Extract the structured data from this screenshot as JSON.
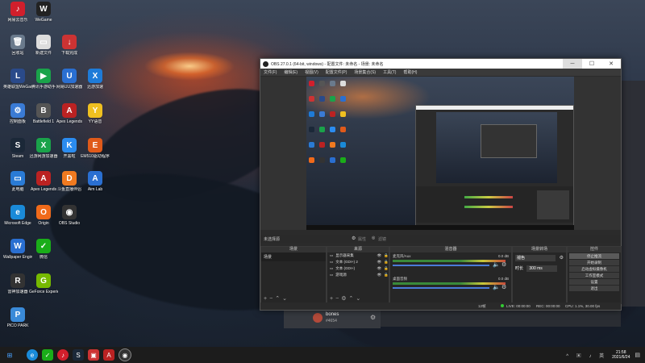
{
  "desktop": {
    "icons": [
      {
        "label": "网易云音乐",
        "color": "#d11f2c",
        "glyph": "♪"
      },
      {
        "label": "WeGame",
        "color": "#222",
        "glyph": "W"
      },
      {
        "label": "回收站",
        "color": "#6a7a8c",
        "glyph": "🗑"
      },
      {
        "label": "新建文件",
        "color": "#ddd",
        "glyph": "▭"
      },
      {
        "label": "下载完成",
        "color": "#c33",
        "glyph": "↓"
      },
      {
        "label": "英雄联盟WeGame版",
        "color": "#2a4a8a",
        "glyph": "L"
      },
      {
        "label": "腾讯手游助手",
        "color": "#1aa34a",
        "glyph": "▶"
      },
      {
        "label": "网易UU加速器",
        "color": "#2a6fd1",
        "glyph": "U"
      },
      {
        "label": "迅游加速",
        "color": "#1e7bd8",
        "glyph": "X"
      },
      {
        "label": "控制面板",
        "color": "#3a7bd5",
        "glyph": "⚙"
      },
      {
        "label": "Battlefield 1",
        "color": "#555",
        "glyph": "B"
      },
      {
        "label": "Apex Legends",
        "color": "#b22",
        "glyph": "A"
      },
      {
        "label": "YY语音",
        "color": "#f0c020",
        "glyph": "Y"
      },
      {
        "label": "Steam",
        "color": "#1b2838",
        "glyph": "S"
      },
      {
        "label": "迅游网游加速器",
        "color": "#1aa34a",
        "glyph": "X"
      },
      {
        "label": "开黑啦",
        "color": "#2b8cf0",
        "glyph": "K"
      },
      {
        "label": "EM510驱动程序",
        "color": "#e05a1a",
        "glyph": "E"
      },
      {
        "label": "此电脑",
        "color": "#2a7bd5",
        "glyph": "▭"
      },
      {
        "label": "Apex Legends",
        "color": "#b22",
        "glyph": "A"
      },
      {
        "label": "斗鱼直播伴侣",
        "color": "#f07a20",
        "glyph": "D"
      },
      {
        "label": "Aim Lab",
        "color": "#2a6fd1",
        "glyph": "A"
      },
      {
        "label": "Microsoft Edge",
        "color": "#1a8ad8",
        "glyph": "e"
      },
      {
        "label": "Origin",
        "color": "#f06a1a",
        "glyph": "O"
      },
      {
        "label": "OBS Studio",
        "color": "#333",
        "glyph": "◉"
      },
      {
        "label": "Wallpaper Engine:...",
        "color": "#2a6fd1",
        "glyph": "W"
      },
      {
        "label": "微信",
        "color": "#1aad19",
        "glyph": "✓"
      },
      {
        "label": "雷神加速器",
        "color": "#333",
        "glyph": "R"
      },
      {
        "label": "GeForce Experience",
        "color": "#76b900",
        "glyph": "G"
      },
      {
        "label": "PICO PARK",
        "color": "#3a8ad8",
        "glyph": "P"
      }
    ]
  },
  "obs": {
    "title": "OBS 27.0.1 (64-bit, windows) - 配置文件: 未命名 - 场景: 未命名",
    "menu": [
      "文件(F)",
      "编辑(E)",
      "视图(V)",
      "配置文件(P)",
      "场景集合(S)",
      "工具(T)",
      "帮助(H)"
    ],
    "status_bar_label": "未选择源",
    "status_bar_buttons": [
      "属性",
      "滤镜"
    ],
    "scenes": {
      "header": "场景",
      "items": [
        "场景"
      ]
    },
    "sources": {
      "header": "来源",
      "items": [
        "显示器采集",
        "文本 (GDI+) 2",
        "文本 (GDI+)",
        "游戏源"
      ]
    },
    "mixer": {
      "header": "混音器",
      "tracks": [
        {
          "name": "麦克风/Aux",
          "db": "0.0 dB"
        },
        {
          "name": "桌面音频",
          "db": "0.0 dB"
        }
      ]
    },
    "transitions": {
      "header": "场景转场",
      "type": "褪色",
      "duration_label": "时长",
      "duration": "300 ms"
    },
    "controls": {
      "header": "控件",
      "buttons": [
        "停止推流",
        "开始录制",
        "启动虚拟摄像机",
        "工作室模式",
        "设置",
        "退出"
      ]
    },
    "status": {
      "live": "LIVE: 00:00:00",
      "rec": "REC: 00:00:00",
      "cpu": "CPU: 1.1%, 30.00 fps",
      "dropped": "12帧"
    }
  },
  "chat": {
    "name": "bones",
    "sub": "#4654"
  },
  "taskbar": {
    "time": "21:58",
    "date": "2021/6/24"
  }
}
